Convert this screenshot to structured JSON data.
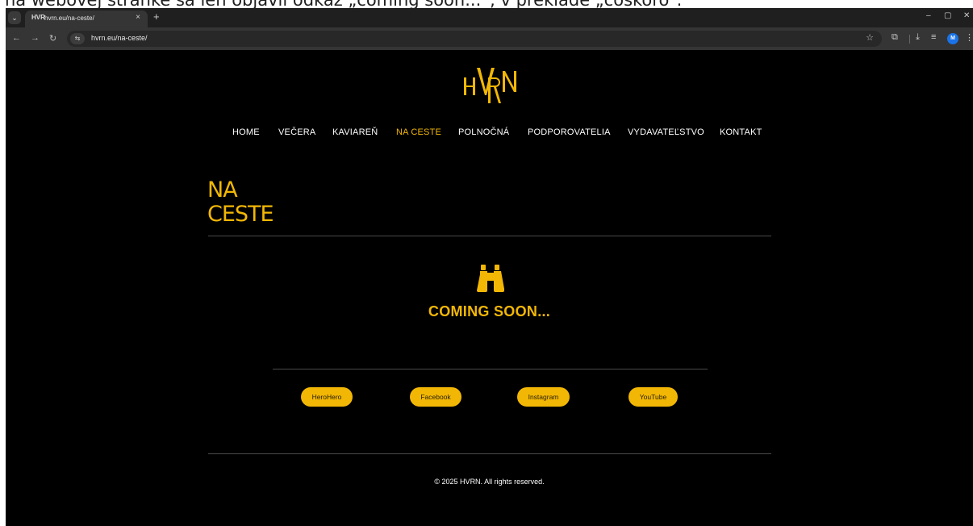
{
  "caption": "na webovej stránke sa len objavil odkaz „coming soon...“, v preklade „čoskoro“.",
  "browser": {
    "tab_title": "hvrn.eu/na-ceste/",
    "tab_favicon": "HVR",
    "tab_close": "×",
    "new_tab": "+",
    "url": "hvrn.eu/na-ceste/",
    "profile_initial": "M",
    "window_controls": [
      "–",
      "▢",
      "✕"
    ]
  },
  "site": {
    "logo_text": "HVRN",
    "nav": [
      {
        "label": "HOME",
        "active": false
      },
      {
        "label": "VEČERA",
        "active": false
      },
      {
        "label": "KAVIAREŇ",
        "active": false
      },
      {
        "label": "NA CESTE",
        "active": true
      },
      {
        "label": "POLNOČNÁ",
        "active": false
      },
      {
        "label": "PODPOROVATELIA",
        "active": false
      },
      {
        "label": "VYDAVATEĽSTVO",
        "active": false
      },
      {
        "label": "KONTAKT",
        "active": false
      }
    ],
    "section_title_line1": "NA",
    "section_title_line2": "CESTE",
    "coming_soon": "COMING SOON...",
    "social": [
      "HeroHero",
      "Facebook",
      "Instagram",
      "YouTube"
    ],
    "footer": "© 2025 HVRN. All rights reserved.",
    "colors": {
      "accent": "#f2b705",
      "background": "#000000",
      "text": "#ffffff"
    }
  }
}
